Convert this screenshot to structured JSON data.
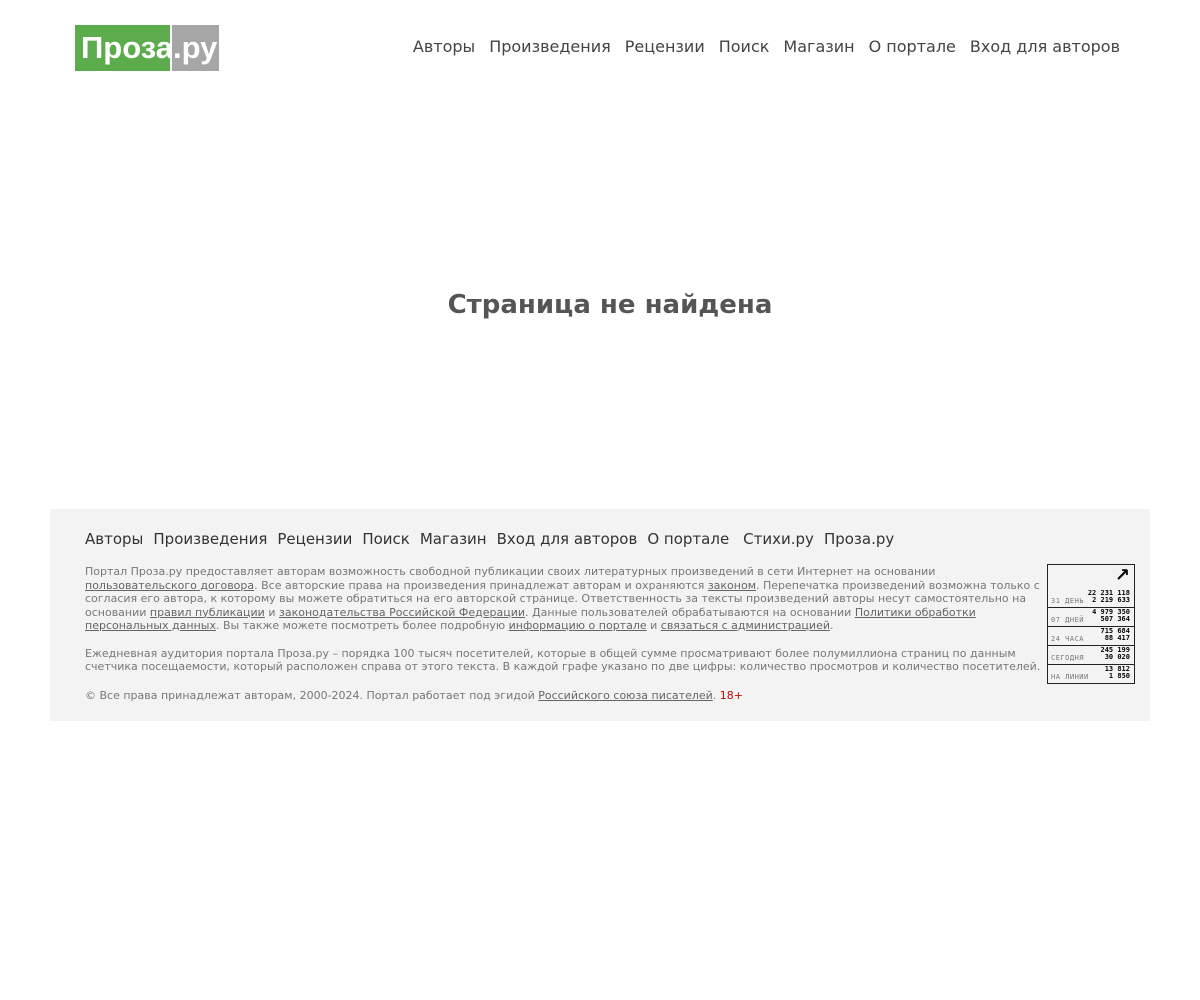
{
  "logo": {
    "left": "Проза",
    "right": ".ру"
  },
  "topnav": [
    "Авторы",
    "Произведения",
    "Рецензии",
    "Поиск",
    "Магазин",
    "О портале",
    "Вход для авторов"
  ],
  "main": {
    "title": "Страница не найдена"
  },
  "footer": {
    "nav": [
      "Авторы",
      "Произведения",
      "Рецензии",
      "Поиск",
      "Магазин",
      "Вход для авторов",
      "О портале",
      "Стихи.ру",
      "Проза.ру"
    ],
    "p1": {
      "t1": "Портал Проза.ру предоставляет авторам возможность свободной публикации своих литературных произведений в сети Интернет на основании ",
      "l1": "пользовательского договора",
      "t2": ". Все авторские права на произведения принадлежат авторам и охраняются ",
      "l2": "законом",
      "t3": ". Перепечатка произведений возможна только с согласия его автора, к которому вы можете обратиться на его авторской странице. Ответственность за тексты произведений авторы несут самостоятельно на основании ",
      "l3": "правил публикации",
      "t4": " и ",
      "l4": "законодательства Российской Федерации",
      "t5": ". Данные пользователей обрабатываются на основании ",
      "l5": "Политики обработки персональных данных",
      "t6": ". Вы также можете посмотреть более подробную ",
      "l6": "информацию о портале",
      "t7": " и ",
      "l7": "связаться с администрацией",
      "t8": "."
    },
    "p2": "Ежедневная аудитория портала Проза.ру – порядка 100 тысяч посетителей, которые в общей сумме просматривают более полумиллиона страниц по данным счетчика посещаемости, который расположен справа от этого текста. В каждой графе указано по две цифры: количество просмотров и количество посетителей.",
    "copyright": {
      "t1": "© Все права принадлежат авторам, 2000-2024.   Портал работает под эгидой ",
      "link": "Российского союза писателей",
      "t2": ". ",
      "age": "18+"
    },
    "counter": {
      "arrow": "↗",
      "rows": [
        {
          "label": "31 ДЕНЬ",
          "v1": "22 231 118",
          "v2": "2 219 633"
        },
        {
          "label": "07 ДНЕЙ",
          "v1": "4 979 350",
          "v2": "507 364"
        },
        {
          "label": "24 ЧАСА",
          "v1": "715 684",
          "v2": "88 417"
        },
        {
          "label": "СЕГОДНЯ",
          "v1": "245 199",
          "v2": "30 020"
        },
        {
          "label": "НА ЛИНИИ",
          "v1": "13 812",
          "v2": "1 850"
        }
      ]
    }
  }
}
